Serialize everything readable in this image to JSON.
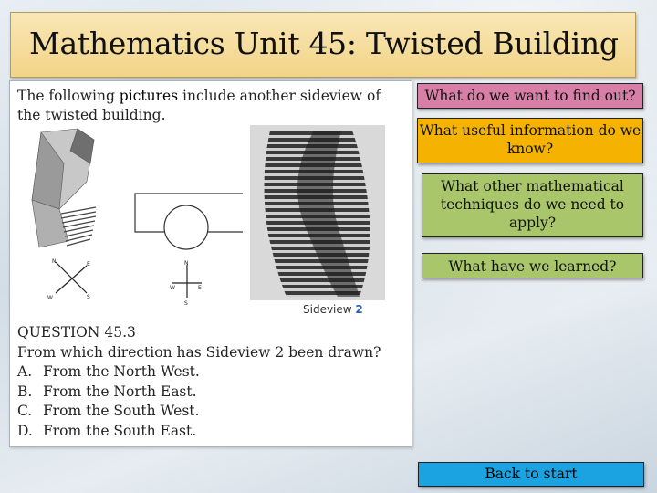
{
  "title": "Mathematics Unit 45: Twisted Building",
  "intro": {
    "before": "The following ",
    "highlight": "pictures",
    "after": " include another sideview of the twisted building."
  },
  "figure": {
    "compass1": {
      "n": "N",
      "e": "E",
      "w": "W",
      "s": "S"
    },
    "compass2": {
      "n": "N",
      "e": "E",
      "w": "W",
      "s": "S"
    },
    "sideview_label": "Sideview ",
    "sideview_number": "2"
  },
  "question": {
    "heading": "QUESTION 45.3",
    "text": "From which direction has Sideview 2 been drawn?",
    "options": [
      {
        "letter": "A.",
        "text": "From the North West."
      },
      {
        "letter": "B.",
        "text": "From the North East."
      },
      {
        "letter": "C.",
        "text": "From the South West."
      },
      {
        "letter": "D.",
        "text": "From the South East."
      }
    ]
  },
  "nav": {
    "find_out": "What do we want to find out?",
    "useful_info": "What useful information do we know?",
    "techniques": "What other mathematical techniques do we need to apply?",
    "learned": "What have we learned?",
    "back": "Back to start"
  },
  "colors": {
    "title_bg": "#f2d487",
    "find_out": "#d77fa6",
    "useful_info": "#f5b300",
    "techniques": "#a9c66a",
    "learned": "#a9c66a",
    "back": "#1aa3e0"
  }
}
